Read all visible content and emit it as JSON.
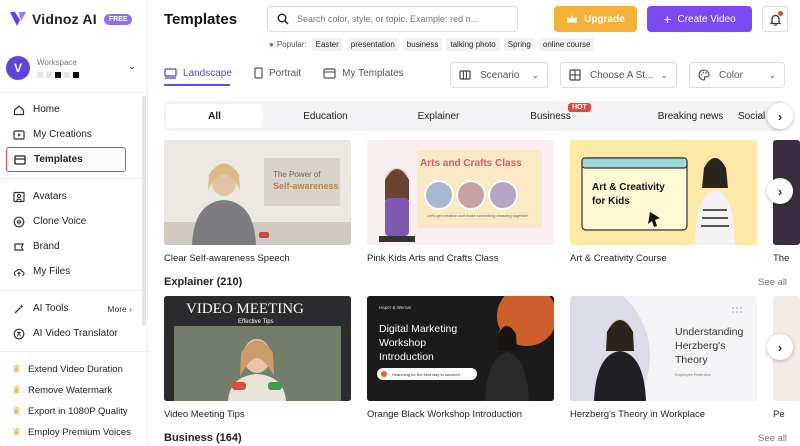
{
  "app": {
    "name": "Vidnoz AI",
    "badge": "FREE"
  },
  "workspace": {
    "label": "Workspace",
    "avatar_letter": "V"
  },
  "nav": {
    "home": "Home",
    "my_creations": "My Creations",
    "templates": "Templates",
    "avatars": "Avatars",
    "clone_voice": "Clone Voice",
    "brand": "Brand",
    "my_files": "My Files",
    "ai_tools": "AI Tools",
    "more": "More",
    "ai_video_translator": "AI Video Translator"
  },
  "perks": [
    "Extend Video Duration",
    "Remove Watermark",
    "Export in 1080P Quality",
    "Employ Premium Voices"
  ],
  "header": {
    "title": "Templates",
    "search_placeholder": "Search color, style, or topic. Example: red n...",
    "popular_label": "Popular:",
    "popular_tags": [
      "Easter",
      "presentation",
      "business",
      "talking photo",
      "Spring",
      "online course"
    ],
    "upgrade": "Upgrade",
    "create_video": "Create Video"
  },
  "tabs": {
    "landscape": "Landscape",
    "portrait": "Portrait",
    "my_templates": "My Templates"
  },
  "filters": {
    "scenario": "Scenario",
    "style": "Choose A St...",
    "color": "Color"
  },
  "categories": [
    "All",
    "Education",
    "Explainer",
    "Business",
    "Breaking news",
    "Social"
  ],
  "category_hot_badge": "HOT",
  "rows": [
    {
      "cards": [
        {
          "title": "Clear Self-awareness Speech",
          "thumb_line1": "The Power of",
          "thumb_line2": "Self-awareness"
        },
        {
          "title": "Pink Kids Arts and Crafts Class",
          "thumb_line1": "Arts and Crafts Class",
          "thumb_line2": "Let's get creative and make something amazing together!"
        },
        {
          "title": "Art & Creativity Course",
          "thumb_line1": "Art & Creativity",
          "thumb_line2": "for Kids"
        },
        {
          "title": "The"
        }
      ]
    },
    {
      "section": "Explainer (210)",
      "see_all": "See all",
      "cards": [
        {
          "title": "Video Meeting Tips",
          "thumb_line1": "VIDEO MEETING",
          "thumb_line2": "Effective Tips"
        },
        {
          "title": "Orange Black Workshop Introduction",
          "thumb_kicker": "Haper & Wemar",
          "thumb_line1": "Digital Marketing",
          "thumb_line2": "Workshop",
          "thumb_line3": "Introduction",
          "thumb_pill": "Searching for the best way to succeed"
        },
        {
          "title": "Herzberg's Theory in Workplace",
          "thumb_line1": "Understanding",
          "thumb_line2": "Herzberg's",
          "thumb_line3": "Theory",
          "thumb_small": "Employee Retention"
        },
        {
          "title": "Pe"
        }
      ]
    },
    {
      "section": "Business (164)",
      "see_all": "See all"
    }
  ],
  "colors": {
    "accent": "#7b4af2",
    "upgrade": "#f6b13b",
    "hot": "#e9463b",
    "active_outline": "#e0463d"
  }
}
